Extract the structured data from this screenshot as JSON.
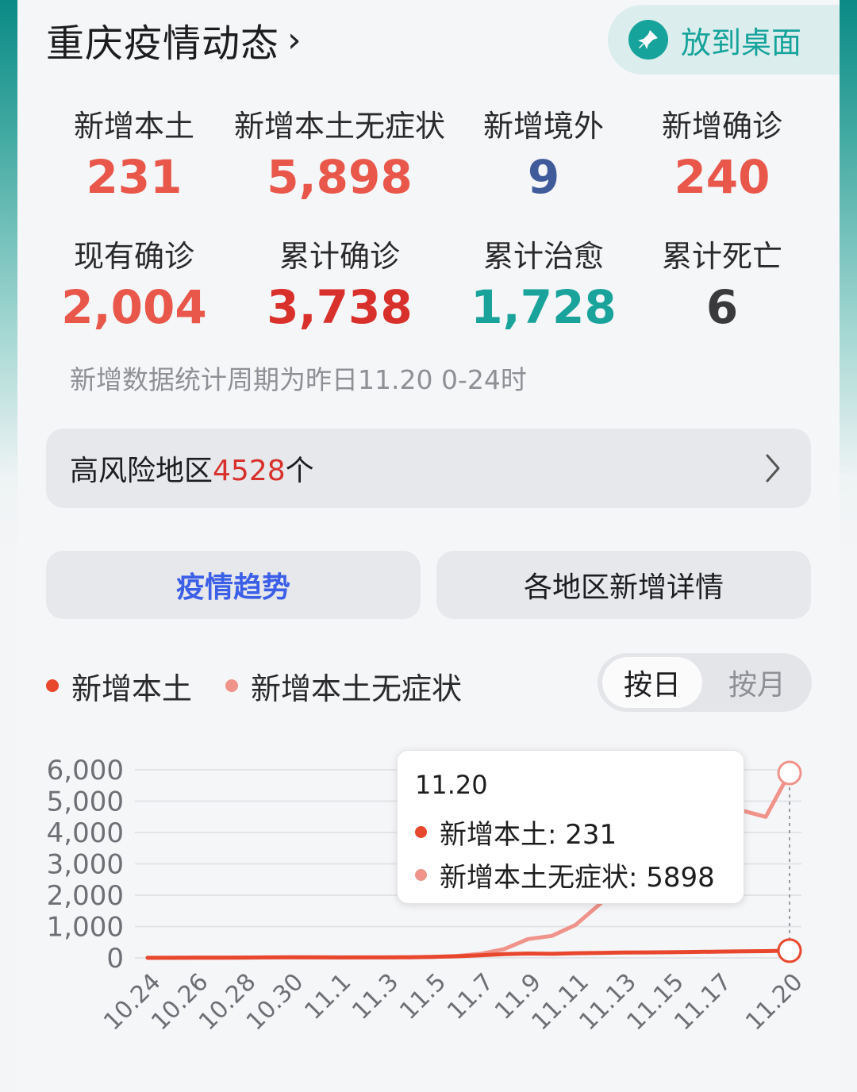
{
  "header": {
    "title": "重庆疫情动态",
    "pin_label": "放到桌面"
  },
  "stats": [
    {
      "label": "新增本土",
      "value": "231",
      "color": "#e8574a"
    },
    {
      "label": "新增本土无症状",
      "value": "5,898",
      "color": "#e8574a"
    },
    {
      "label": "新增境外",
      "value": "9",
      "color": "#3f5b9a"
    },
    {
      "label": "新增确诊",
      "value": "240",
      "color": "#e8574a"
    },
    {
      "label": "现有确诊",
      "value": "2,004",
      "color": "#e8574a"
    },
    {
      "label": "累计确诊",
      "value": "3,738",
      "color": "#d8302a"
    },
    {
      "label": "累计治愈",
      "value": "1,728",
      "color": "#19a39b"
    },
    {
      "label": "累计死亡",
      "value": "6",
      "color": "#3a3a3c"
    }
  ],
  "note": "新增数据统计周期为昨日11.20 0-24时",
  "risk": {
    "prefix": "高风险地区",
    "count": "4528",
    "suffix": "个"
  },
  "tabs": [
    {
      "label": "疫情趋势"
    },
    {
      "label": "各地区新增详情"
    }
  ],
  "legend": [
    {
      "label": "新增本土",
      "color": "#e8472e"
    },
    {
      "label": "新增本土无症状",
      "color": "#f0938a"
    }
  ],
  "toggle": {
    "day": "按日",
    "month": "按月"
  },
  "tooltip": {
    "date": "11.20",
    "line1": "新增本土: 231",
    "line2": "新增本土无症状: 5898"
  },
  "chart_data": {
    "type": "line",
    "x": [
      "10.24",
      "10.25",
      "10.26",
      "10.27",
      "10.28",
      "10.29",
      "10.30",
      "10.31",
      "11.1",
      "11.2",
      "11.3",
      "11.4",
      "11.5",
      "11.6",
      "11.7",
      "11.8",
      "11.9",
      "11.10",
      "11.11",
      "11.12",
      "11.13",
      "11.14",
      "11.15",
      "11.16",
      "11.17",
      "11.18",
      "11.19",
      "11.20"
    ],
    "x_tick_labels": [
      "10.24",
      "10.26",
      "10.28",
      "10.30",
      "11.1",
      "11.3",
      "11.5",
      "11.7",
      "11.9",
      "11.11",
      "11.13",
      "11.15",
      "11.17",
      "11.20"
    ],
    "series": [
      {
        "name": "新增本土",
        "color": "#e8472e",
        "values": [
          2,
          3,
          5,
          8,
          10,
          15,
          20,
          18,
          15,
          14,
          15,
          20,
          30,
          50,
          80,
          120,
          140,
          130,
          150,
          160,
          170,
          175,
          180,
          190,
          200,
          210,
          215,
          231
        ]
      },
      {
        "name": "新增本土无症状",
        "color": "#f0938a",
        "values": [
          1,
          2,
          4,
          6,
          8,
          12,
          15,
          12,
          10,
          12,
          15,
          20,
          30,
          60,
          130,
          280,
          600,
          700,
          1050,
          1700,
          2400,
          3100,
          3700,
          4100,
          4450,
          4700,
          4500,
          5898
        ]
      }
    ],
    "yticks": [
      "6,000",
      "5,000",
      "4,000",
      "3,000",
      "2,000",
      "1,000",
      "0"
    ],
    "ylim": [
      0,
      6000
    ],
    "grid": true
  }
}
